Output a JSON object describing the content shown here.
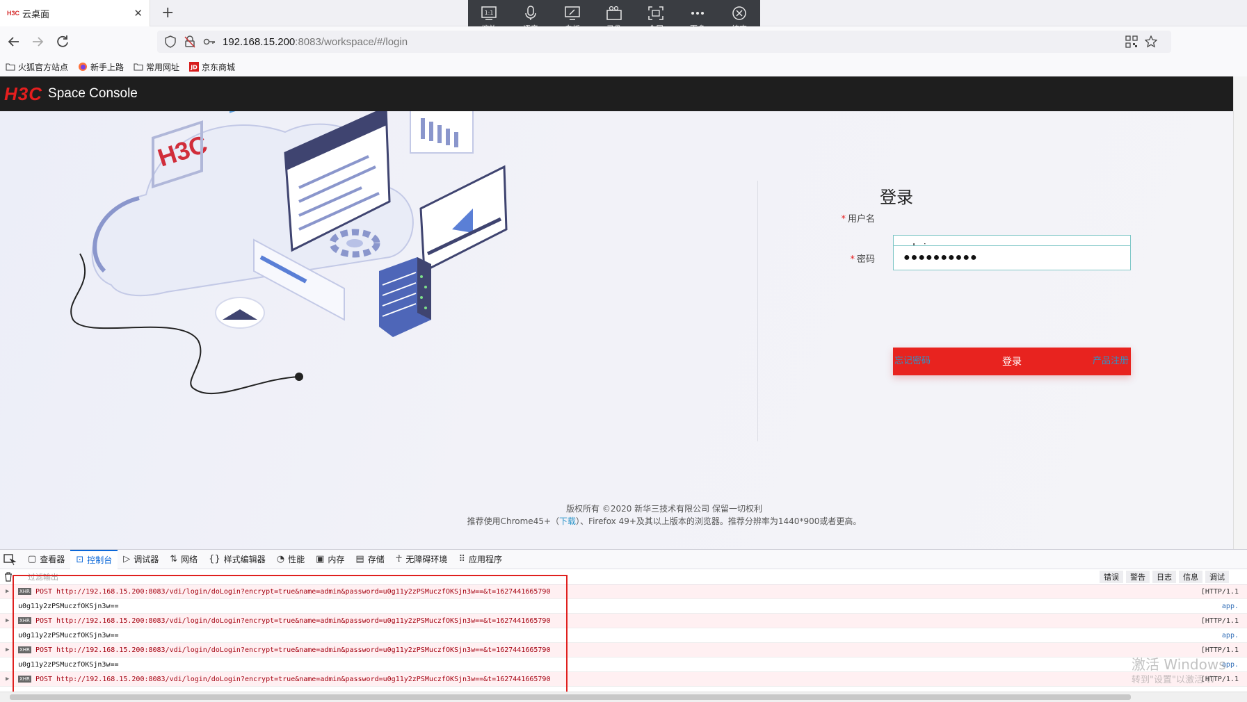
{
  "browser": {
    "tab": {
      "favicon_text": "H3C",
      "title": "云桌面"
    },
    "url": {
      "host": "192.168.15.200",
      "rest": ":8083/workspace/#/login"
    },
    "bookmarks": [
      {
        "label": "火狐官方站点"
      },
      {
        "label": "新手上路"
      },
      {
        "label": "常用网址"
      },
      {
        "label": "京东商城"
      }
    ]
  },
  "remote_toolbar": [
    {
      "label": "缩放",
      "icon": "zoom-icon"
    },
    {
      "label": "语音",
      "icon": "microphone-icon"
    },
    {
      "label": "白板",
      "icon": "whiteboard-icon"
    },
    {
      "label": "录像",
      "icon": "record-icon"
    },
    {
      "label": "全屏",
      "icon": "fullscreen-icon"
    },
    {
      "label": "更多",
      "icon": "more-icon"
    },
    {
      "label": "结束",
      "icon": "end-icon"
    }
  ],
  "app": {
    "logo": "H3C",
    "name": "Space Console",
    "illustration_logo": "H3C",
    "login": {
      "title": "登录",
      "username_label": "用户名",
      "username_value": "admin",
      "password_label": "密码",
      "password_value": "●●●●●●●●●●",
      "submit": "登录",
      "forgot": "忘记密码",
      "register": "产品注册"
    },
    "footer": {
      "copyright": "版权所有 ©2020 新华三技术有限公司 保留一切权利",
      "recommend_pre": "推荐使用Chrome45+（",
      "recommend_link": "下载",
      "recommend_post": "）、Firefox 49+及其以上版本的浏览器。推荐分辨率为1440*900或者更高。"
    }
  },
  "devtools": {
    "tabs": [
      {
        "label": "查看器",
        "icon": "inspector-icon"
      },
      {
        "label": "控制台",
        "icon": "console-icon",
        "active": true
      },
      {
        "label": "调试器",
        "icon": "debugger-icon"
      },
      {
        "label": "网络",
        "icon": "network-icon"
      },
      {
        "label": "样式编辑器",
        "icon": "style-editor-icon"
      },
      {
        "label": "性能",
        "icon": "performance-icon"
      },
      {
        "label": "内存",
        "icon": "memory-icon"
      },
      {
        "label": "存储",
        "icon": "storage-icon"
      },
      {
        "label": "无障碍环境",
        "icon": "accessibility-icon"
      },
      {
        "label": "应用程序",
        "icon": "application-icon"
      }
    ],
    "filter_placeholder": "过滤输出",
    "levels": [
      "错误",
      "警告",
      "日志",
      "信息",
      "调试"
    ],
    "xhr_tag": "XHR",
    "logs": [
      {
        "type": "xhr",
        "text": "POST http://192.168.15.200:8083/vdi/login/doLogin?encrypt=true&name=admin&password=u0g11y2zPSMuczfOKSjn3w==&t=1627441665790",
        "right": "[HTTP/1.1"
      },
      {
        "type": "txt",
        "text": "u0g11y2zPSMuczfOKSjn3w==",
        "right": "app."
      },
      {
        "type": "xhr",
        "text": "POST http://192.168.15.200:8083/vdi/login/doLogin?encrypt=true&name=admin&password=u0g11y2zPSMuczfOKSjn3w==&t=1627441665790",
        "right": "[HTTP/1.1"
      },
      {
        "type": "txt",
        "text": "u0g11y2zPSMuczfOKSjn3w==",
        "right": "app."
      },
      {
        "type": "xhr",
        "text": "POST http://192.168.15.200:8083/vdi/login/doLogin?encrypt=true&name=admin&password=u0g11y2zPSMuczfOKSjn3w==&t=1627441665790",
        "right": "[HTTP/1.1"
      },
      {
        "type": "txt",
        "text": "u0g11y2zPSMuczfOKSjn3w==",
        "right": "app."
      },
      {
        "type": "xhr",
        "text": "POST http://192.168.15.200:8083/vdi/login/doLogin?encrypt=true&name=admin&password=u0g11y2zPSMuczfOKSjn3w==&t=1627441665790",
        "right": "[HTTP/1.1"
      }
    ]
  },
  "watermark": {
    "line1": "激活 Windows",
    "line2": "转到\"设置\"以激活 W"
  },
  "colors": {
    "accent_red": "#e8231f",
    "link_blue": "#2d95c9",
    "header_bg": "#1e1e1e"
  }
}
